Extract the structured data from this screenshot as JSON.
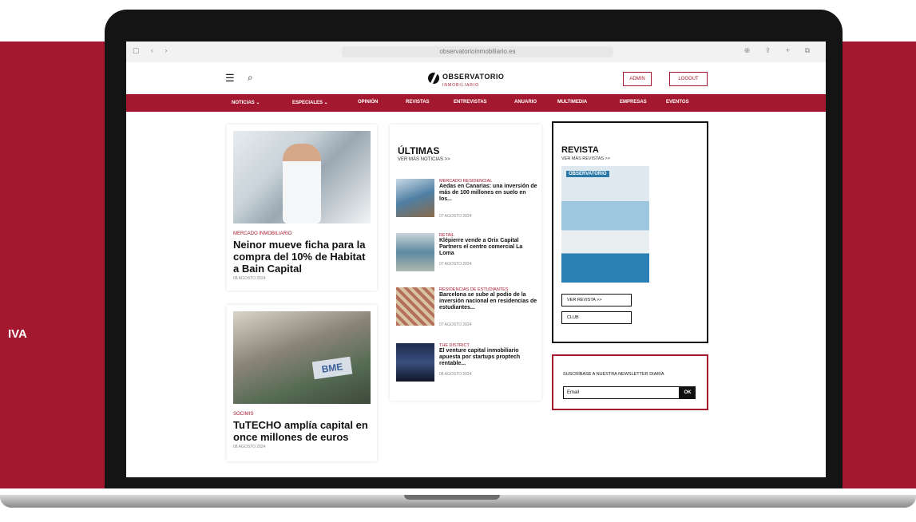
{
  "side_text": "IVA",
  "browser": {
    "url": "observatorioinmobiliario.es"
  },
  "header": {
    "logo_title": "OBSERVATORIO",
    "logo_sub": "INMOBILIARIO",
    "admin_label": "ADMIN",
    "logout_label": "LOGOUT"
  },
  "nav": {
    "items": [
      "NOTICIAS ⌄",
      "ESPECIALES ⌄",
      "OPINIÓN",
      "REVISTAS",
      "ENTREVISTAS",
      "ANUARIO",
      "MULTIMEDIA",
      "EMPRESAS",
      "EVENTOS"
    ]
  },
  "featured": [
    {
      "category": "MERCADO INMOBILIARIO",
      "title": "Neinor mueve ficha para la compra del 10% de Habitat a Bain Capital",
      "date": "08 AGOSTO 2024"
    },
    {
      "category": "SOCIMIS",
      "title": "TuTECHO amplía capital en once millones de euros",
      "date": "08 AGOSTO 2024"
    }
  ],
  "ultimas": {
    "title": "ÚLTIMAS",
    "more": "VER MÁS NOTICIAS >>",
    "items": [
      {
        "category": "MERCADO RESIDENCIAL",
        "title": "Aedas en Canarias: una inversión de más de 100 millones en suelo en los...",
        "date": "07 AGOSTO 2024"
      },
      {
        "category": "RETAIL",
        "title": "Klépierre vende a Orix Capital Partners el centro comercial La Loma",
        "date": "07 AGOSTO 2024"
      },
      {
        "category": "RESIDENCIAS DE ESTUDIANTES",
        "title": "Barcelona se sube al podio de la inversión nacional en residencias de estudiantes...",
        "date": "07 AGOSTO 2024"
      },
      {
        "category": "THE DISTRICT",
        "title": "El venture capital inmobiliario apuesta por startups proptech rentable...",
        "date": "08 AGOSTO 2024"
      }
    ]
  },
  "revista": {
    "title": "REVISTA",
    "more": "VER MÁS REVISTAS >>",
    "cover_logo": "OBSERVATORIO",
    "ver_revista": "VER REVISTA >>",
    "club": "CLUB"
  },
  "newsletter": {
    "text": "SUSCRÍBASE A NUESTRA NEWSLETTER DIARIA",
    "placeholder": "Email",
    "ok": "OK"
  }
}
